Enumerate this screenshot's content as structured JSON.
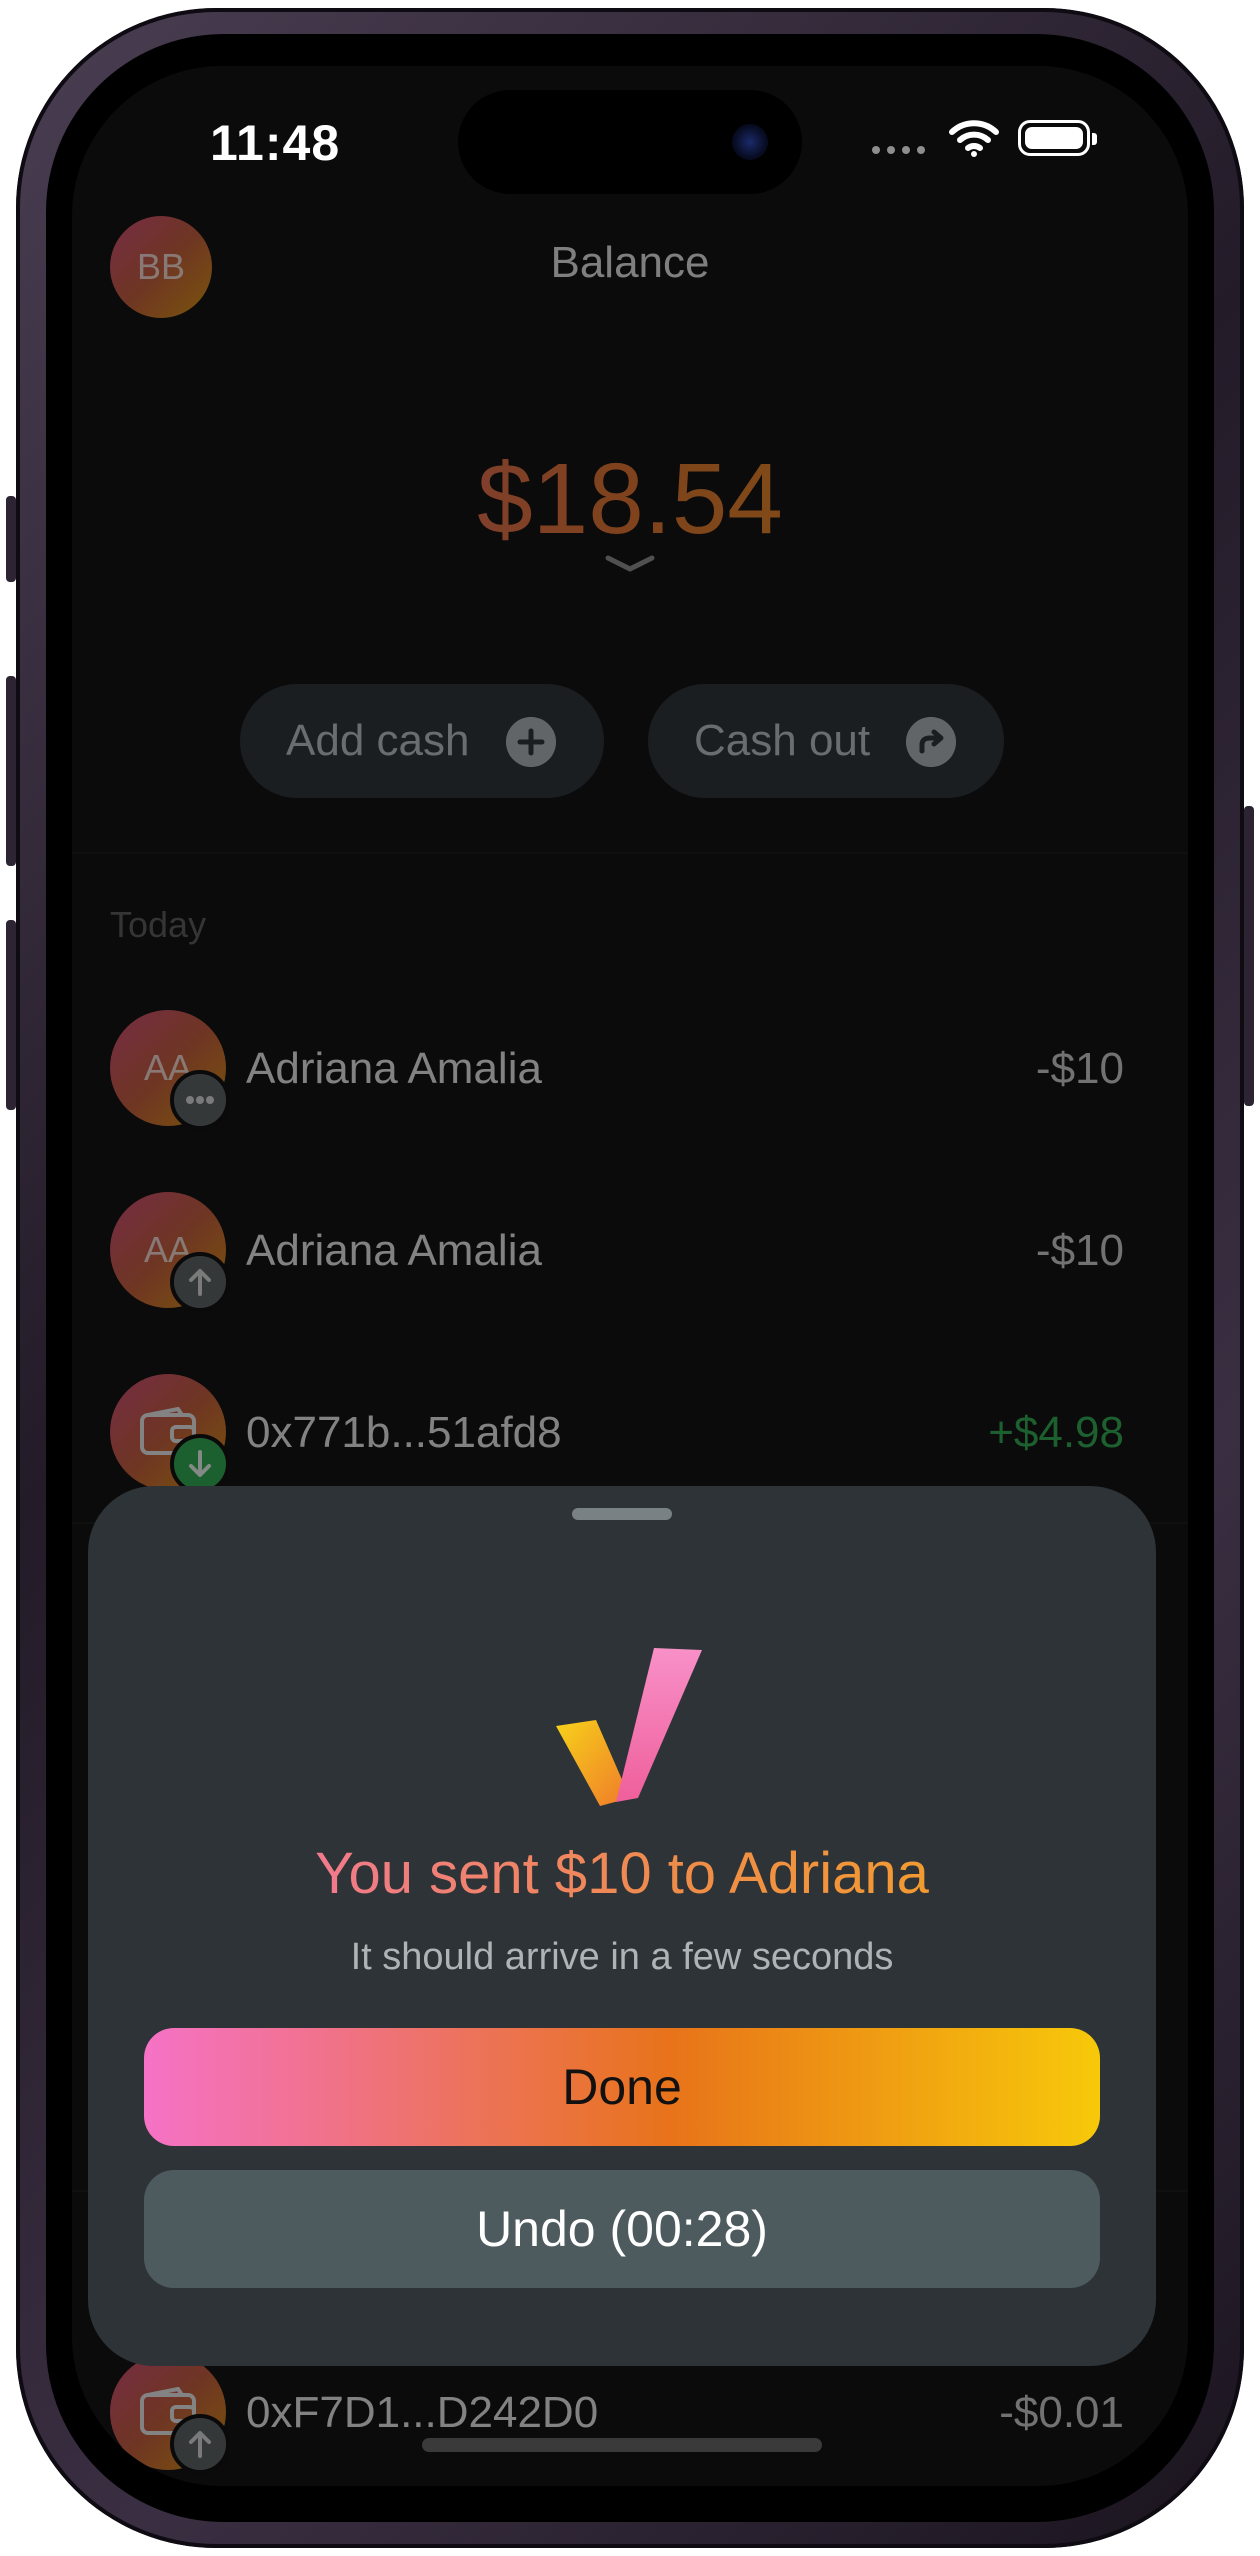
{
  "status_bar": {
    "time": "11:48"
  },
  "header": {
    "avatar_initials": "BB",
    "title": "Balance"
  },
  "balance": {
    "amount": "$18.54"
  },
  "actions": {
    "add_cash_label": "Add cash",
    "cash_out_label": "Cash out"
  },
  "transactions": {
    "section_label": "Today",
    "items": [
      {
        "initials": "AA",
        "name": "Adriana Amalia",
        "amount": "-$10",
        "badge": "more-icon"
      },
      {
        "initials": "AA",
        "name": "Adriana Amalia",
        "amount": "-$10",
        "badge": "arrow-up-icon"
      },
      {
        "initials": "",
        "name": "0x771b...51afd8",
        "amount": "+$4.98",
        "badge": "arrow-down-icon",
        "amount_color": "#2fa84f"
      },
      {
        "initials": "",
        "name": "0xF7D1...D242D0",
        "amount": "-$0.01",
        "badge": "arrow-up-icon"
      }
    ]
  },
  "sheet": {
    "title": "You sent $10 to Adriana",
    "subtitle": "It should arrive in a few seconds",
    "done_label": "Done",
    "undo_label": "Undo (00:28)"
  },
  "colors": {
    "background": "#0b0b0b",
    "sheet": "#2d3336",
    "accent_pink": "#f572c6",
    "accent_orange": "#e8731a",
    "accent_yellow": "#f7c90a",
    "positive": "#2fa84f"
  }
}
